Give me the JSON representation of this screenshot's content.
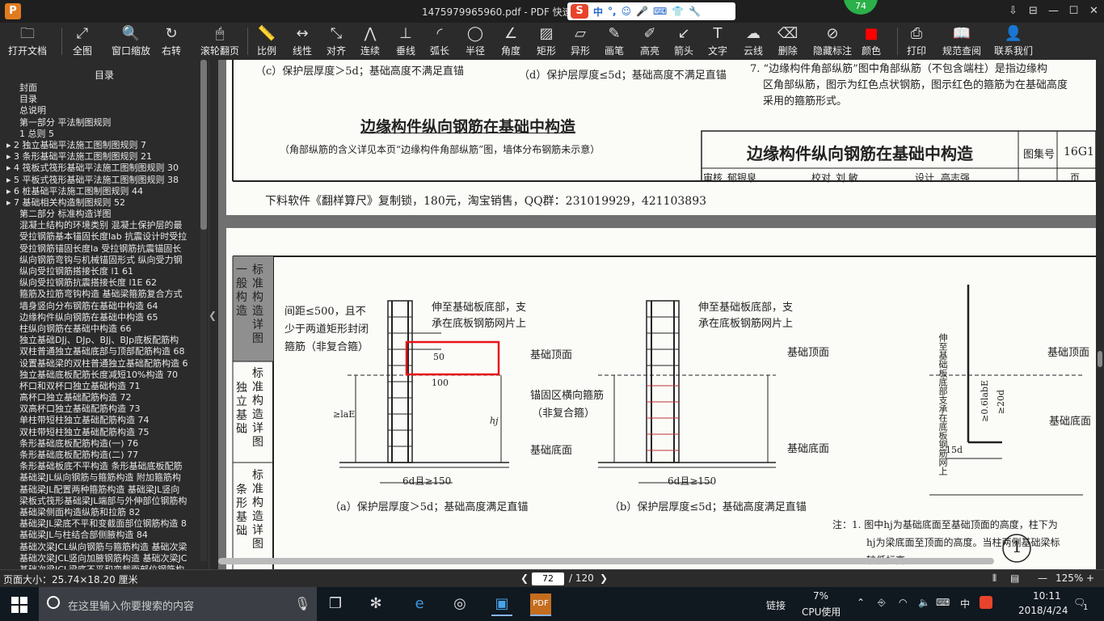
{
  "window": {
    "title": "1475979965960.pdf - PDF 快速看",
    "app_icon": "P",
    "badge": "74",
    "ime": {
      "logo": "S",
      "items": [
        "中",
        "°,",
        "☺",
        "🎤",
        "⌨",
        "👕",
        "🔧"
      ]
    },
    "controls": [
      "⇩",
      "⊟",
      "—",
      "☐",
      "✕"
    ]
  },
  "toolbar": {
    "items": [
      {
        "label": "打开文档",
        "icon": "folder-icon",
        "glyph": "🗀"
      },
      {
        "label": "全图",
        "icon": "fit-page-icon",
        "glyph": "⤢"
      },
      {
        "label": "窗口缩放",
        "icon": "zoom-icon",
        "glyph": "🔍"
      },
      {
        "label": "右转",
        "icon": "rotate-right-icon",
        "glyph": "↻"
      },
      {
        "label": "滚轮翻页",
        "icon": "mouse-wheel-icon",
        "glyph": "🖱"
      },
      {
        "label": "比例",
        "icon": "scale-icon",
        "glyph": "📏"
      },
      {
        "label": "线性",
        "icon": "linear-measure-icon",
        "glyph": "↔"
      },
      {
        "label": "对齐",
        "icon": "align-icon",
        "glyph": "⤡"
      },
      {
        "label": "连续",
        "icon": "continuous-measure-icon",
        "glyph": "⋀"
      },
      {
        "label": "垂线",
        "icon": "perpendicular-icon",
        "glyph": "⊥"
      },
      {
        "label": "弧长",
        "icon": "arc-length-icon",
        "glyph": "◜"
      },
      {
        "label": "半径",
        "icon": "radius-icon",
        "glyph": "◯"
      },
      {
        "label": "角度",
        "icon": "angle-icon",
        "glyph": "∠"
      },
      {
        "label": "矩形",
        "icon": "rectangle-area-icon",
        "glyph": "▨"
      },
      {
        "label": "异形",
        "icon": "polygon-area-icon",
        "glyph": "▱"
      },
      {
        "label": "画笔",
        "icon": "pen-icon",
        "glyph": "✎"
      },
      {
        "label": "高亮",
        "icon": "highlight-icon",
        "glyph": "✐"
      },
      {
        "label": "箭头",
        "icon": "arrow-icon",
        "glyph": "↙"
      },
      {
        "label": "文字",
        "icon": "text-icon",
        "glyph": "T"
      },
      {
        "label": "云线",
        "icon": "cloud-line-icon",
        "glyph": "☁"
      },
      {
        "label": "删除",
        "icon": "eraser-icon",
        "glyph": "⌫"
      },
      {
        "label": "隐藏标注",
        "icon": "hide-annotation-icon",
        "glyph": "⊘"
      },
      {
        "label": "颜色",
        "icon": "color-icon",
        "glyph": "■"
      },
      {
        "label": "打印",
        "icon": "print-icon",
        "glyph": "⎙"
      },
      {
        "label": "规范查阅",
        "icon": "spec-book-icon",
        "glyph": "📖"
      },
      {
        "label": "联系我们",
        "icon": "contact-icon",
        "glyph": "👤"
      }
    ],
    "color_swatch": "#ff0000"
  },
  "sidebar": {
    "header": "目录",
    "items": [
      "封面",
      "目录",
      "总说明",
      "第一部分 平法制图规则",
      "1 总则 5",
      "2 独立基础平法施工图制图规则 7",
      "3 条形基础平法施工图制图规则 21",
      "4 筏板式筏形基础平法施工图制图规则 30",
      "5 平板式筏形基础平法施工图制图规则 38",
      "6 桩基础平法施工图制图规则 44",
      "7 基础相关构造制图规则 52",
      "第二部分 标准构造详图",
      "混凝土结构的环境类别 混凝土保护层的最",
      "受拉钢筋基本锚固长度lab 抗震设计时受拉",
      "受拉钢筋锚固长度la 受拉钢筋抗震锚固长",
      "纵向钢筋弯钩与机械锚固形式 纵向受力钢",
      "纵向受拉钢筋搭接长度 l1 61",
      "纵向受拉钢筋抗震搭接长度 l1E 62",
      "箍筋及拉筋弯钩构造 基础梁箍筋复合方式",
      "墙身竖向分布钢筋在基础中构造 64",
      "边缘构件纵向钢筋在基础中构造 65",
      "柱纵向钢筋在基础中构造 66",
      "独立基础DJj、DJp、BJj、BJp底板配筋构",
      "双柱普通独立基础底部与顶部配筋构造 68",
      "设置基础梁的双柱普通独立基础配筋构造 6",
      "独立基础底板配筋长度减短10%构造 70",
      "杯口和双杯口独立基础构造 71",
      "高杯口独立基础配筋构造 72",
      "双高杯口独立基础配筋构造 73",
      "单柱带短柱独立基础配筋构造 74",
      "双柱带短柱独立基础配筋构造 75",
      "条形基础底板配筋构造(一) 76",
      "条形基础底板配筋构造(二) 77",
      "条形基础板底不平构造 条形基础底板配筋",
      "基础梁JL纵向钢筋与箍筋构造 附加箍筋构",
      "基础梁JL配置两种箍筋构造 基础梁JL竖向",
      "梁板式筏形基础梁JL端部与外伸部位钢筋构",
      "基础梁侧面构造纵筋和拉筋 82",
      "基础梁JL梁底不平和变截面部位钢筋构造 8",
      "基础梁JL与柱结合部侧腋构造 84",
      "基础次梁JCL纵向钢筋与箍筋构造 基础次梁",
      "基础次梁JCL竖向加腋钢筋构造 基础次梁JC",
      "基础次梁JCL梁底不平和变截面部位钢筋构"
    ]
  },
  "page1": {
    "note_c": "（c）保护层厚度＞5d；基础高度不满足直锚",
    "note_d": "（d）保护层厚度≤5d；基础高度不满足直锚",
    "right_note_1": "7. “边缘构件角部纵筋”图中角部纵筋（不包含端柱）是指边缘构",
    "right_note_2": "区角部纵筋，图示为红色点状钢筋，图示红色的箍筋为在基础高度",
    "right_note_3": "采用的箍筋形式。",
    "heading": "边缘构件纵向钢筋在基础中构造",
    "subheading": "（角部纵筋的含义详见本页“边缘构件角部纵筋”图，墙体分布钢筋未示意）",
    "titleblock_main": "边缘构件纵向钢筋在基础中构造",
    "titleblock_atlas_label": "图集号",
    "titleblock_atlas_value": "16G1",
    "titleblock_row": [
      "审核",
      "郁银泉",
      "校对",
      "刘 敏",
      "设计",
      "高志强",
      "页"
    ],
    "footer": "下料软件《翻样算尺》复制锁，180元，淘宝销售，QQ群：231019929，421103893"
  },
  "page2": {
    "side_tabs": [
      {
        "a": "一般构造",
        "b": "标准构造详图"
      },
      {
        "a": "独立基础",
        "b": "标准构造详图"
      },
      {
        "a": "条形基础",
        "b": "标准构造详图"
      }
    ],
    "note_spacing_1": "间距≤500，且不",
    "note_spacing_2": "少于两道矩形封闭",
    "note_spacing_3": "箍筋（非复合箍）",
    "note_extend_a1": "伸至基础板底部，支",
    "note_extend_a2": "承在底板钢筋网片上",
    "note_extend_b1": "伸至基础板底部，支",
    "note_extend_b2": "承在底板钢筋网片上",
    "dim_50": "50",
    "dim_100": "100",
    "label_top_a": "基础顶面",
    "label_bottom_a": "基础底面",
    "label_anchor_1": "锚固区横向箍筋",
    "label_anchor_2": "（非复合箍）",
    "label_top_b": "基础顶面",
    "label_bottom_b": "基础底面",
    "label_top_c": "基础顶面",
    "label_bottom_c": "基础底面",
    "label_lab": "≥laE",
    "label_hj": "hj",
    "dim_6d": "6d且≥150",
    "dim_15d": "15d",
    "dim_06lab": "≥0.6labE",
    "dim_20d": "≥20d",
    "vertical_note": "伸至基础板底部支承在底板钢筋网上",
    "caption_a": "（a）保护层厚度＞5d；基础高度满足直锚",
    "caption_b": "（b）保护层厚度≤5d；基础高度满足直锚",
    "circle_num": "1",
    "footnote_1": "注：1. 图中hj为基础底面至基础顶面的高度，柱下为",
    "footnote_2": "hj为梁底面至顶面的高度。当柱两侧基础梁标",
    "footnote_3": "较低标高。",
    "highlight_color": "#e8141a"
  },
  "statusbar": {
    "page_size": "页面大小：25.74×18.20 厘米",
    "current_page": "72",
    "total_pages": "/ 120",
    "zoom": "125%",
    "zoom_minus": "—",
    "zoom_plus": "+"
  },
  "taskbar": {
    "search_placeholder": "在这里输入你要搜索的内容",
    "link_label": "链接",
    "cpu_value": "7%",
    "cpu_label": "CPU使用",
    "lang": "中",
    "time": "10:11",
    "date": "2018/4/24",
    "notif": "1"
  }
}
